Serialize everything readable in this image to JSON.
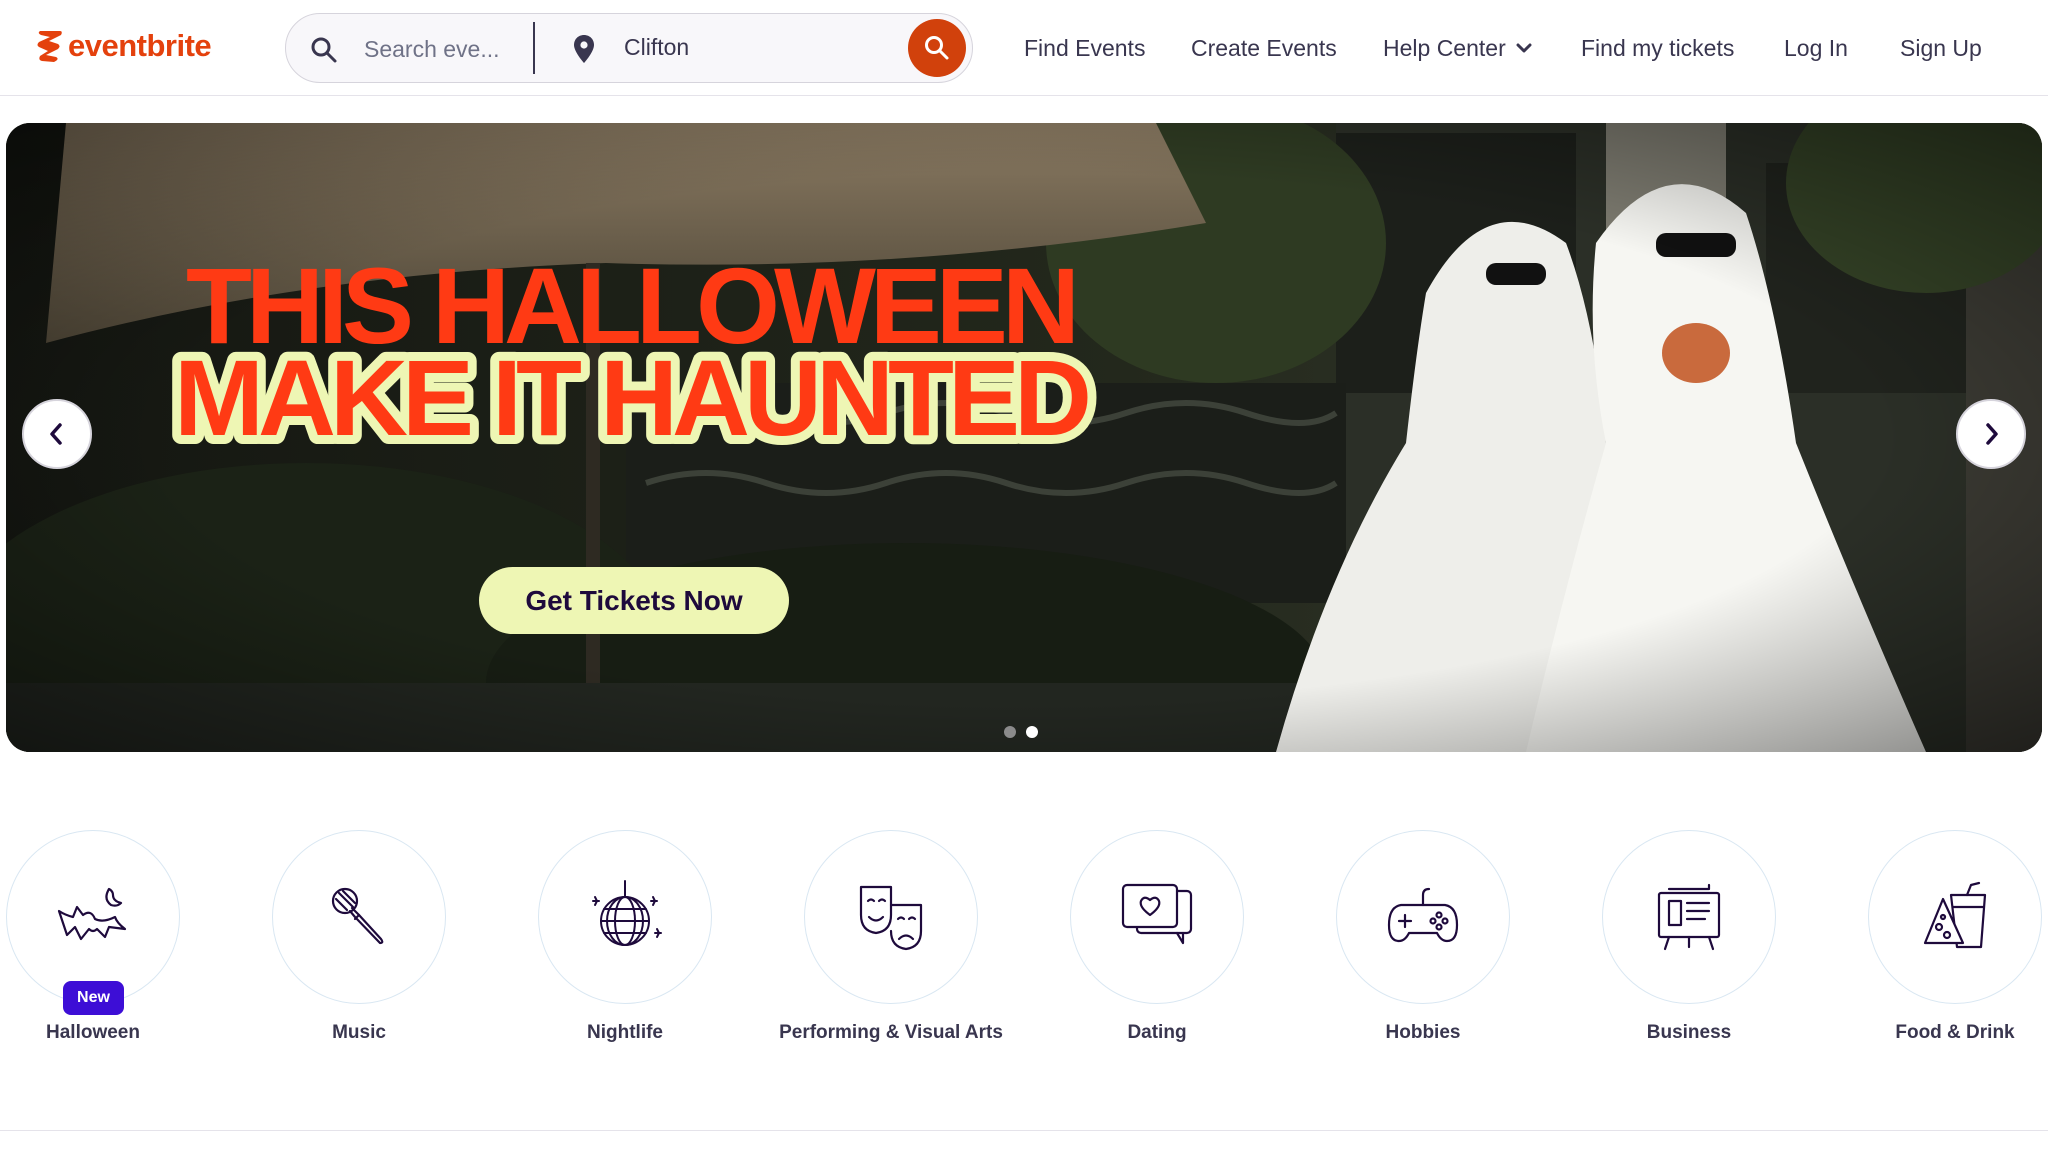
{
  "brand": {
    "name": "eventbrite",
    "color": "#e4410d"
  },
  "search": {
    "placeholder": "Search eve...",
    "location": "Clifton",
    "button_color": "#d1410c"
  },
  "nav": {
    "find_events": "Find Events",
    "create_events": "Create Events",
    "help_center": "Help Center",
    "find_tickets": "Find my tickets",
    "log_in": "Log In",
    "sign_up": "Sign Up"
  },
  "hero": {
    "headline_line1": "THIS HALLOWEEN",
    "headline_line2": "MAKE IT HAUNTED",
    "cta_label": "Get Tickets Now",
    "slide_count": 2,
    "active_slide": 2,
    "headline_color": "#ff3a14",
    "cta_color": "#eef6b4"
  },
  "categories": [
    {
      "label": "Halloween",
      "icon": "bat-moon-icon",
      "badge": "New"
    },
    {
      "label": "Music",
      "icon": "microphone-icon"
    },
    {
      "label": "Nightlife",
      "icon": "disco-ball-icon"
    },
    {
      "label": "Performing & Visual Arts",
      "icon": "theater-masks-icon"
    },
    {
      "label": "Dating",
      "icon": "chat-heart-icon"
    },
    {
      "label": "Hobbies",
      "icon": "gamepad-icon"
    },
    {
      "label": "Business",
      "icon": "presentation-board-icon"
    },
    {
      "label": "Food & Drink",
      "icon": "food-drink-icon"
    }
  ]
}
